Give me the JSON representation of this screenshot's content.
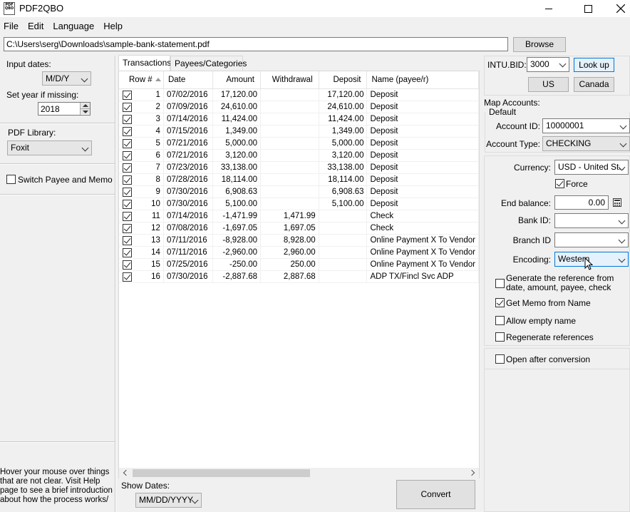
{
  "window": {
    "title": "PDF2QBO",
    "app_icon_text": "PDF QBO"
  },
  "menu": [
    "File",
    "Edit",
    "Language",
    "Help"
  ],
  "file_path": "C:\\Users\\serg\\Downloads\\sample-bank-statement.pdf",
  "browse_label": "Browse",
  "left": {
    "input_dates_label": "Input dates:",
    "input_dates_value": "M/D/Y",
    "set_year_label": "Set year if missing:",
    "set_year_value": "2018",
    "pdf_library_label": "PDF Library:",
    "pdf_library_value": "Foxit",
    "switch_payee_label": "Switch Payee and Memo",
    "switch_payee_checked": false,
    "hover_help": "Hover your mouse over things that are not clear. Visit Help page to see a brief introduction about how the process works/"
  },
  "tabs": [
    "Transactions",
    "Payees/Categories"
  ],
  "grid": {
    "columns": [
      "Row #",
      "Date",
      "Amount",
      "Withdrawal",
      "Deposit",
      "Name (payee/r)"
    ],
    "rows": [
      {
        "n": "1",
        "date": "07/02/2016",
        "amount": "17,120.00",
        "withdrawal": "",
        "deposit": "17,120.00",
        "name": "Deposit"
      },
      {
        "n": "2",
        "date": "07/09/2016",
        "amount": "24,610.00",
        "withdrawal": "",
        "deposit": "24,610.00",
        "name": "Deposit"
      },
      {
        "n": "3",
        "date": "07/14/2016",
        "amount": "11,424.00",
        "withdrawal": "",
        "deposit": "11,424.00",
        "name": "Deposit"
      },
      {
        "n": "4",
        "date": "07/15/2016",
        "amount": "1,349.00",
        "withdrawal": "",
        "deposit": "1,349.00",
        "name": "Deposit"
      },
      {
        "n": "5",
        "date": "07/21/2016",
        "amount": "5,000.00",
        "withdrawal": "",
        "deposit": "5,000.00",
        "name": "Deposit"
      },
      {
        "n": "6",
        "date": "07/21/2016",
        "amount": "3,120.00",
        "withdrawal": "",
        "deposit": "3,120.00",
        "name": "Deposit"
      },
      {
        "n": "7",
        "date": "07/23/2016",
        "amount": "33,138.00",
        "withdrawal": "",
        "deposit": "33,138.00",
        "name": "Deposit"
      },
      {
        "n": "8",
        "date": "07/28/2016",
        "amount": "18,114.00",
        "withdrawal": "",
        "deposit": "18,114.00",
        "name": "Deposit"
      },
      {
        "n": "9",
        "date": "07/30/2016",
        "amount": "6,908.63",
        "withdrawal": "",
        "deposit": "6,908.63",
        "name": "Deposit"
      },
      {
        "n": "10",
        "date": "07/30/2016",
        "amount": "5,100.00",
        "withdrawal": "",
        "deposit": "5,100.00",
        "name": "Deposit"
      },
      {
        "n": "11",
        "date": "07/14/2016",
        "amount": "-1,471.99",
        "withdrawal": "1,471.99",
        "deposit": "",
        "name": "Check"
      },
      {
        "n": "12",
        "date": "07/08/2016",
        "amount": "-1,697.05",
        "withdrawal": "1,697.05",
        "deposit": "",
        "name": "Check"
      },
      {
        "n": "13",
        "date": "07/11/2016",
        "amount": "-8,928.00",
        "withdrawal": "8,928.00",
        "deposit": "",
        "name": "Online Payment X To Vendor"
      },
      {
        "n": "14",
        "date": "07/11/2016",
        "amount": "-2,960.00",
        "withdrawal": "2,960.00",
        "deposit": "",
        "name": "Online Payment X To Vendor"
      },
      {
        "n": "15",
        "date": "07/25/2016",
        "amount": "-250.00",
        "withdrawal": "250.00",
        "deposit": "",
        "name": "Online Payment X To Vendor"
      },
      {
        "n": "16",
        "date": "07/30/2016",
        "amount": "-2,887.68",
        "withdrawal": "2,887.68",
        "deposit": "",
        "name": "ADP TX/Fincl Svc ADP"
      }
    ]
  },
  "show_dates_label": "Show Dates:",
  "show_dates_value": "MM/DD/YYYY",
  "convert_label": "Convert",
  "right": {
    "intu_bid_label": "INTU.BID:",
    "intu_bid_value": "3000",
    "lookup_label": "Look up",
    "us_label": "US",
    "canada_label": "Canada",
    "map_accounts_label": "Map Accounts:",
    "default_label": "Default",
    "account_id_label": "Account ID:",
    "account_id_value": "10000001",
    "account_type_label": "Account Type:",
    "account_type_value": "CHECKING",
    "currency_label": "Currency:",
    "currency_value": "USD - United Sta",
    "force_label": "Force",
    "end_balance_label": "End balance:",
    "end_balance_value": "0.00",
    "bank_id_label": "Bank ID:",
    "branch_id_label": "Branch ID",
    "encoding_label": "Encoding:",
    "encoding_value": "Western",
    "gen_ref_label": "Generate the reference from date, amount, payee, check",
    "get_memo_label": "Get Memo from Name",
    "allow_empty_label": "Allow empty name",
    "regen_label": "Regenerate references",
    "open_after_label": "Open after conversion"
  }
}
